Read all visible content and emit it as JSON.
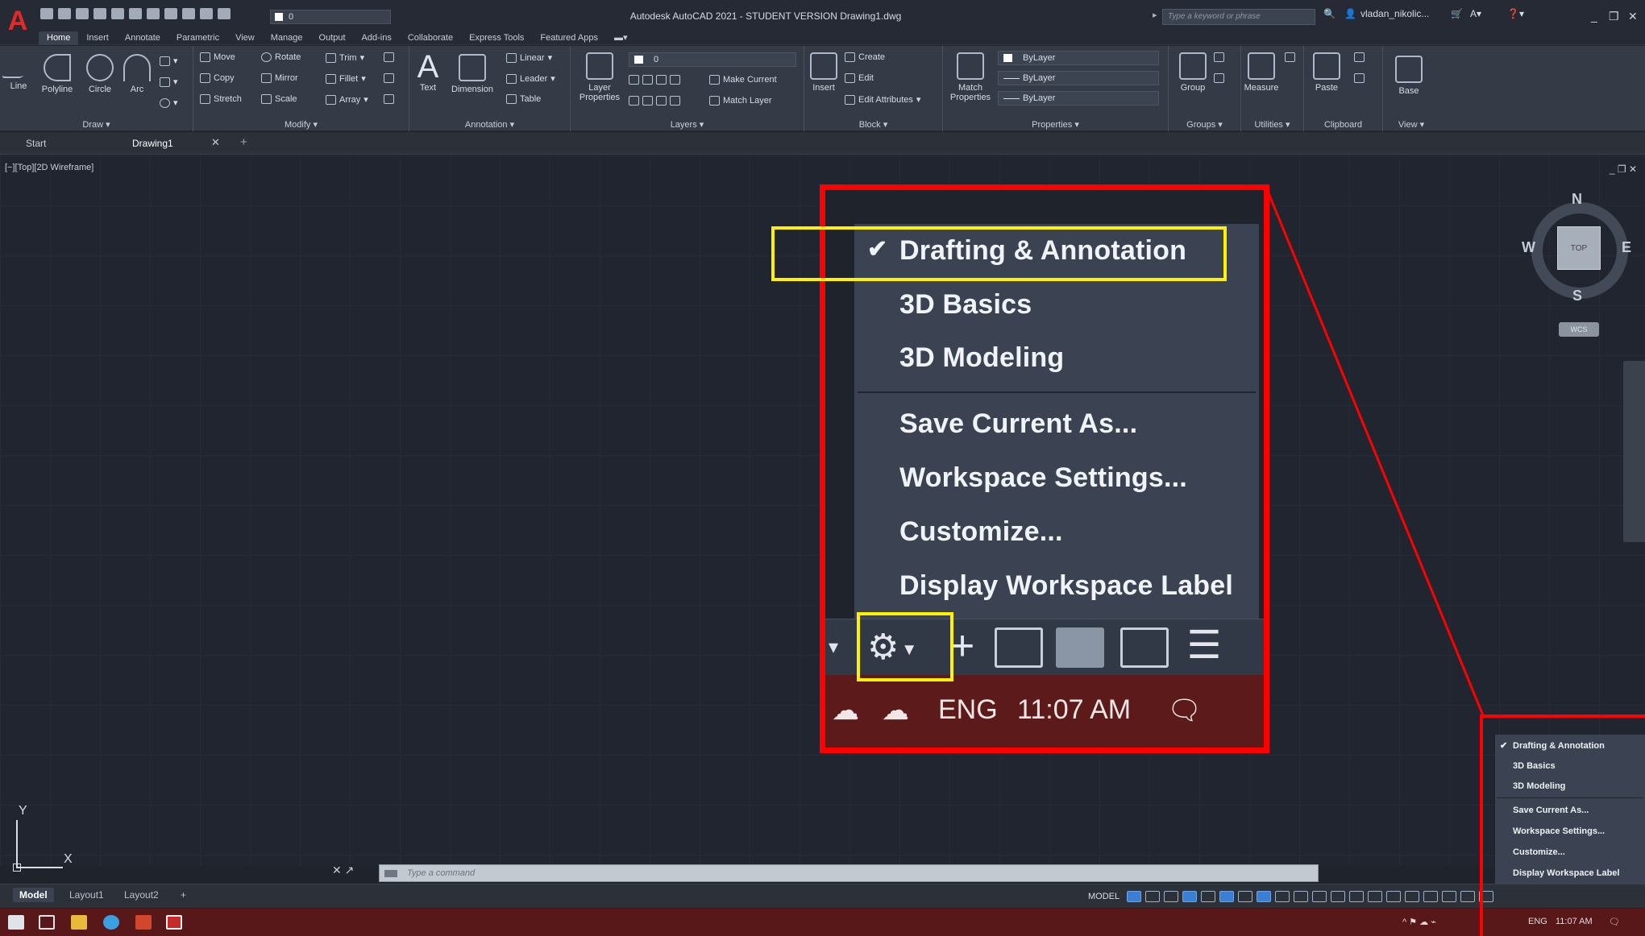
{
  "titlebar": {
    "title": "Autodesk AutoCAD 2021 - STUDENT VERSION   Drawing1.dwg",
    "search_placeholder": "Type a keyword or phrase",
    "user": "vladan_nikolic...",
    "layer_combo": "0",
    "min": "_",
    "restore": "❐",
    "close": "✕"
  },
  "ribbon_tabs": [
    "Home",
    "Insert",
    "Annotate",
    "Parametric",
    "View",
    "Manage",
    "Output",
    "Add-ins",
    "Collaborate",
    "Express Tools",
    "Featured Apps"
  ],
  "panels": {
    "draw": {
      "title": "Draw",
      "tools": [
        "Line",
        "Polyline",
        "Circle",
        "Arc"
      ]
    },
    "modify": {
      "title": "Modify",
      "tools": [
        "Move",
        "Rotate",
        "Trim",
        "Copy",
        "Mirror",
        "Fillet",
        "Stretch",
        "Scale",
        "Array"
      ]
    },
    "annotation": {
      "title": "Annotation",
      "tools": [
        "Text",
        "Dimension",
        "Linear",
        "Leader",
        "Table"
      ]
    },
    "layers": {
      "title": "Layers",
      "tools": [
        "Layer Properties",
        "Make Current",
        "Match Layer"
      ]
    },
    "block": {
      "title": "Block",
      "tools": [
        "Insert",
        "Create",
        "Edit",
        "Edit Attributes"
      ]
    },
    "properties": {
      "title": "Properties",
      "tools": [
        "Match Properties"
      ],
      "rows": [
        "ByLayer",
        "ByLayer",
        "ByLayer"
      ]
    },
    "groups": {
      "title": "Groups",
      "tools": [
        "Group"
      ]
    },
    "utilities": {
      "title": "Utilities",
      "tools": [
        "Measure"
      ]
    },
    "clipboard": {
      "title": "Clipboard",
      "tools": [
        "Paste"
      ]
    },
    "view": {
      "title": "View",
      "tools": [
        "Base"
      ]
    }
  },
  "file_tabs": [
    "Start",
    "Drawing1"
  ],
  "file_tab_close": "✕",
  "file_tab_add": "+",
  "viewport_label": "[−][Top][2D Wireframe]",
  "viewport_controls": "_ ❐ ✕",
  "viewcube": {
    "n": "N",
    "s": "S",
    "e": "E",
    "w": "W",
    "face": "TOP",
    "wcs": "WCS"
  },
  "ucs": {
    "x": "X",
    "y": "Y"
  },
  "command_line": {
    "placeholder": "Type a command",
    "tools": "✕ ↗"
  },
  "layout_tabs": [
    "Model",
    "Layout1",
    "Layout2"
  ],
  "layout_add": "+",
  "status": {
    "model": "MODEL"
  },
  "workspace_menu": {
    "items": [
      "Drafting & Annotation",
      "3D Basics",
      "3D Modeling",
      "Save Current As...",
      "Workspace Settings...",
      "Customize...",
      "Display Workspace Label"
    ],
    "checked": "Drafting & Annotation",
    "check_glyph": "✔"
  },
  "tray": {
    "lang": "ENG",
    "time": "11:07 AM"
  },
  "colors": {
    "highlight_red": "#ff0000",
    "highlight_yellow": "#fff100",
    "taskbar": "#581718",
    "accent_blue": "#3b7fd4",
    "logo_red": "#e22a2a"
  }
}
